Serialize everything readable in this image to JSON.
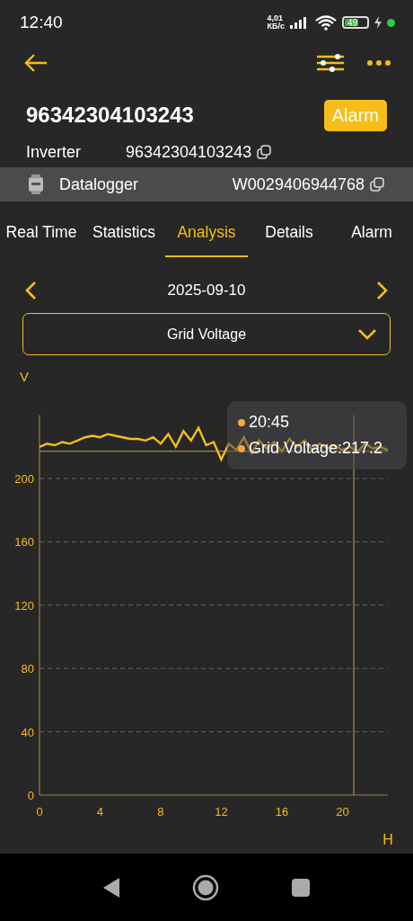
{
  "status_bar": {
    "time": "12:40",
    "speed": "4,01",
    "speed_unit": "КБ/с",
    "battery": "49"
  },
  "header": {
    "title": "96342304103243",
    "alarm_button": "Alarm"
  },
  "info_rows": [
    {
      "kind": "plain",
      "label": "Inverter",
      "value": "96342304103243"
    },
    {
      "kind": "device",
      "label": "Datalogger",
      "value": "W0029406944768"
    }
  ],
  "tabs": [
    {
      "label": "Real Time",
      "selected": false
    },
    {
      "label": "Statistics",
      "selected": false
    },
    {
      "label": "Analysis",
      "selected": true
    },
    {
      "label": "Details",
      "selected": false
    },
    {
      "label": "Alarm",
      "selected": false
    }
  ],
  "date_nav": {
    "date": "2025-09-10"
  },
  "dropdown": {
    "value": "Grid Voltage"
  },
  "chart": {
    "chart_data": {
      "type": "line",
      "xlabel": "H",
      "ylabel": "V",
      "xlim": [
        0,
        23
      ],
      "ylim": [
        0,
        240
      ],
      "xticks": [
        0,
        4,
        8,
        12,
        16,
        20
      ],
      "grid": true,
      "ref_lines": [
        {
          "axis": "x",
          "value": 20.75
        },
        {
          "axis": "y",
          "value": 217.2
        }
      ],
      "yticks": [
        0,
        40,
        80,
        120,
        160,
        200
      ],
      "x": [
        0,
        0.5,
        1,
        1.5,
        2,
        2.5,
        3,
        3.5,
        4,
        4.5,
        5,
        5.5,
        6,
        6.5,
        7,
        7.5,
        8,
        8.5,
        9,
        9.5,
        10,
        10.5,
        11,
        11.5,
        12,
        12.5,
        13,
        13.5,
        14,
        14.5,
        15,
        15.5,
        16,
        16.5,
        17,
        17.5,
        18,
        18.5,
        19,
        19.5,
        20,
        20.5,
        21,
        21.5,
        22,
        22.5,
        23
      ],
      "series": [
        {
          "name": "Grid Voltage",
          "color": "#f5be19",
          "values": [
            220,
            222,
            221,
            223,
            222,
            224,
            226,
            227,
            226,
            228,
            227,
            226,
            225,
            225,
            224,
            226,
            222,
            228,
            220,
            230,
            224,
            232,
            221,
            223,
            212,
            222,
            218,
            226,
            216,
            224,
            219,
            223,
            217,
            225,
            220,
            224,
            218,
            222,
            219,
            221,
            218,
            220,
            217,
            222,
            219,
            220,
            218
          ]
        }
      ]
    },
    "tooltip": {
      "time": "20:45",
      "value": ":217.2"
    }
  }
}
